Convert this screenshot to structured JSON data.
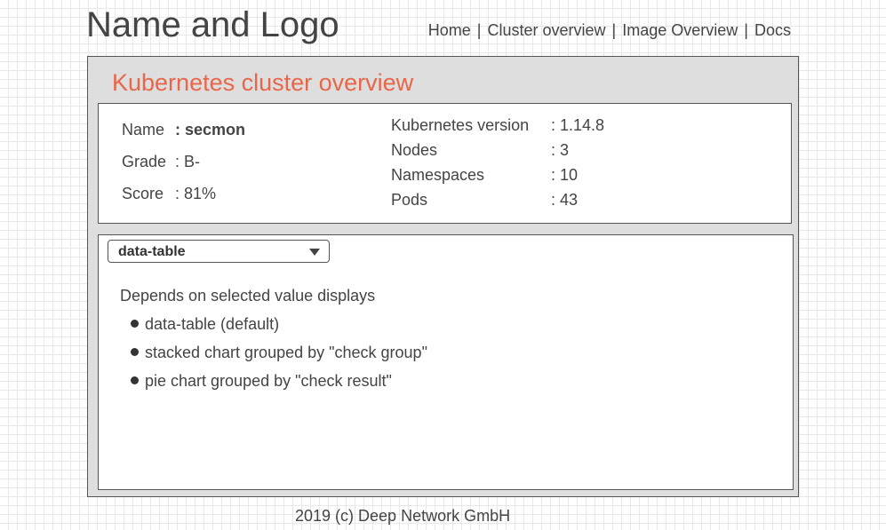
{
  "header": {
    "logo_text": "Name and Logo",
    "nav": [
      {
        "label": "Home"
      },
      {
        "label": "Cluster overview"
      },
      {
        "label": "Image Overview"
      },
      {
        "label": "Docs"
      }
    ],
    "separator": "|"
  },
  "panel": {
    "title": "Kubernetes cluster overview",
    "title_color": "#e8664a",
    "left_info": {
      "name": {
        "label": "Name",
        "value": ": secmon"
      },
      "grade": {
        "label": "Grade",
        "value": ": B-"
      },
      "score": {
        "label": "Score",
        "value": ": 81%"
      }
    },
    "right_info": {
      "k8s_version": {
        "label": "Kubernetes version",
        "value": ": 1.14.8"
      },
      "nodes": {
        "label": "Nodes",
        "value": ": 3"
      },
      "namespaces": {
        "label": "Namespaces",
        "value": ": 10"
      },
      "pods": {
        "label": "Pods",
        "value": ": 43"
      }
    }
  },
  "content": {
    "view_select": {
      "selected": "data-table",
      "icon": "chevron-down-icon"
    },
    "description": "Depends on selected value displays",
    "options": [
      "data-table (default)",
      "stacked chart grouped by \"check group\"",
      "pie chart grouped by \"check result\""
    ]
  },
  "footer": {
    "text": "2019 (c) Deep Network GmbH"
  }
}
